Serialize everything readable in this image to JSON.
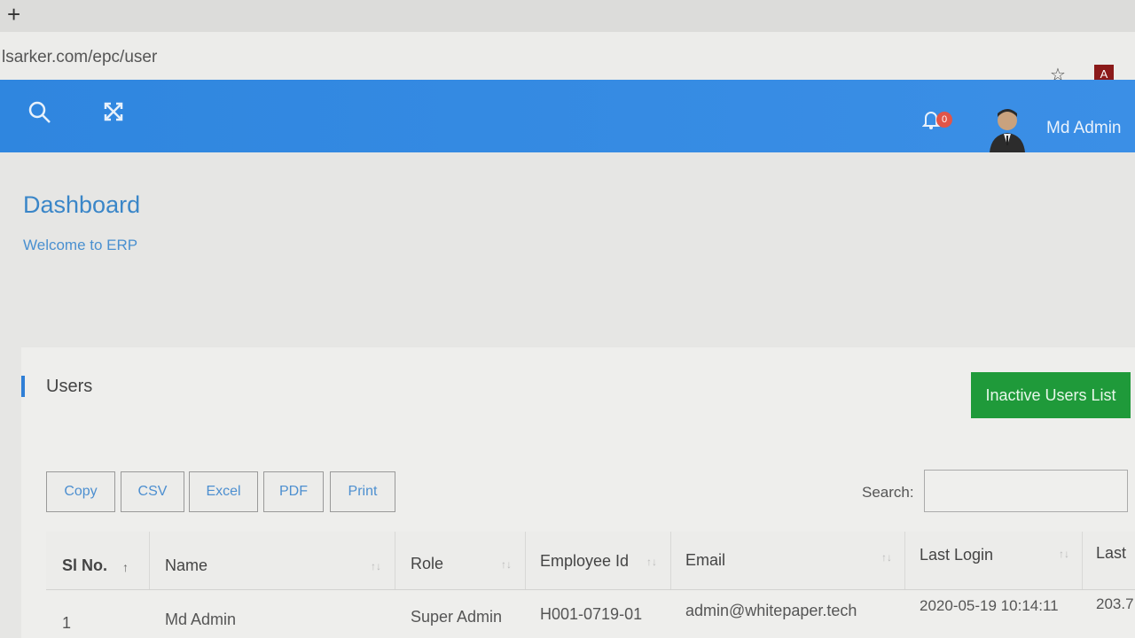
{
  "browser": {
    "url": "lsarker.com/epc/user",
    "new_tab": "+",
    "ext_icon": "A"
  },
  "topnav": {
    "notification_count": "0",
    "user_name": "Md Admin",
    "color": "#3089e2"
  },
  "page": {
    "title": "Dashboard",
    "subtitle": "Welcome to ERP"
  },
  "card": {
    "title": "Users",
    "inactive_button": "Inactive Users List",
    "export_buttons": [
      "Copy",
      "CSV",
      "Excel",
      "PDF",
      "Print"
    ],
    "search_label": "Search:",
    "search_value": ""
  },
  "table": {
    "headers": [
      "Sl No.",
      "Name",
      "Role",
      "Employee Id",
      "Email",
      "Last Login",
      "Last"
    ],
    "rows": [
      [
        "1",
        "Md Admin",
        "Super Admin",
        "H001-0719-01",
        "admin@whitepaper.tech",
        "2020-05-19 10:14:11",
        "203.7"
      ]
    ]
  }
}
